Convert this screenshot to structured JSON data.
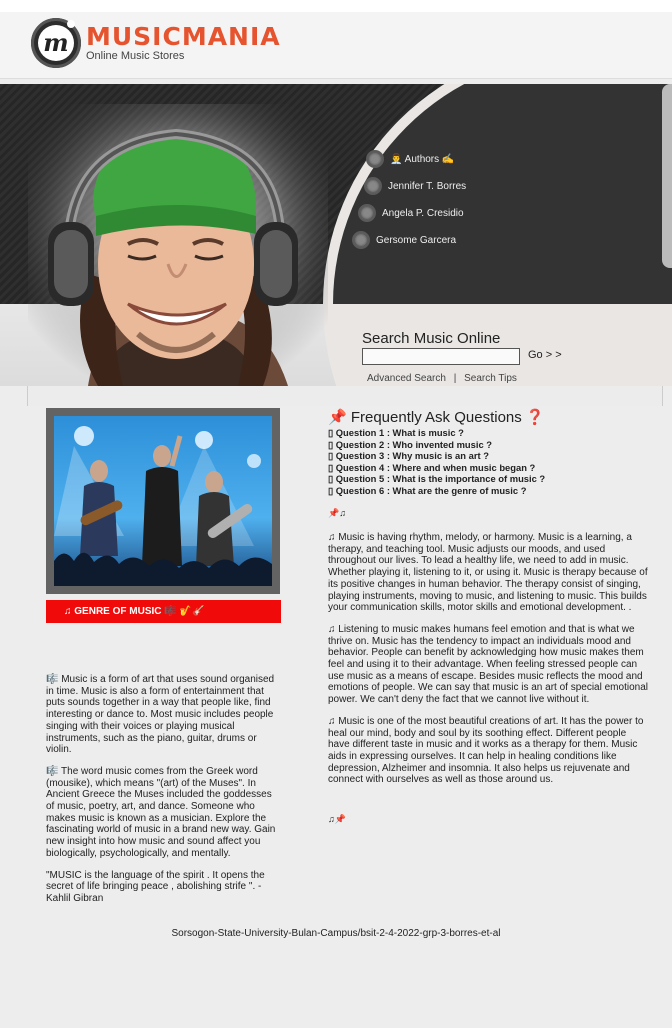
{
  "brand": {
    "name": "MUSICMANIA",
    "tagline": "Online Music Stores",
    "logo_letter": "m"
  },
  "nav": {
    "items": [
      {
        "label": "👨‍💼 Authors ✍"
      },
      {
        "label": "Jennifer T. Borres"
      },
      {
        "label": "Angela P. Cresidio"
      },
      {
        "label": "Gersome Garcera"
      }
    ]
  },
  "search": {
    "title": "Search Music Online",
    "placeholder": "",
    "go_label": "Go > >",
    "advanced_label": "Advanced Search",
    "separator": "|",
    "tips_label": "Search Tips"
  },
  "sidebar": {
    "genre_label": "♫ GENRE OF MUSIC 🎼 🎷🎸",
    "paragraphs": [
      "🎼 Music is a form of art that uses sound organised in time. Music is also a form of entertainment that puts sounds together in a way that people like, find interesting or dance to. Most music includes people singing with their voices or playing musical instruments, such as the piano, guitar, drums or violin.",
      "🎼 The word music comes from the Greek word (mousike), which means \"(art) of the Muses\". In Ancient Greece the Muses included the goddesses of music, poetry, art, and dance. Someone who makes music is known as a musician. Explore the fascinating world of music in a brand new way. Gain new insight into how music and sound affect you biologically, psychologically, and mentally.",
      "\"MUSIC is the language of the spirit . It opens the secret of life bringing peace , abolishing strife \". -Kahlil Gibran"
    ]
  },
  "faq": {
    "title": "📌 Frequently Ask Questions ❓",
    "questions": [
      "▯ Question 1 : What is music ?",
      "▯ Question 2 : Who invented music ?",
      "▯ Question 3 : Why music is an art ?",
      "▯ Question 4 : Where and when music began ?",
      "▯ Question 5 : What is the importance of music ?",
      "▯ Question 6 : What are the genre of music ?"
    ],
    "pin_top": "📌♫",
    "paragraphs": [
      "♫ Music is having rhythm, melody, or harmony. Music is a learning, a therapy, and teaching tool. Music adjusts our moods, and used throughout our lives. To lead a healthy life, we need to add in music. Whether playing it, listening to it, or using it. Music is therapy because of its positive changes in human behavior. The therapy consist of singing, playing instruments, moving to music, and listening to music. This builds your communication skills, motor skills and emotional development. .",
      "♫ Listening to music makes humans feel emotion and that is what we thrive on. Music has the tendency to impact an individuals mood and behavior. People can benefit by acknowledging how music makes them feel and using it to their advantage. When feeling stressed people can use music as a means of escape. Besides music reflects the mood and emotions of people. We can say that music is an art of special emotional power. We can't deny the fact that we cannot live without it.",
      "♫ Music is one of the most beautiful creations of art. It has the power to heal our mind, body and soul by its soothing effect. Different people have different taste in music and it works as a therapy for them. Music aids in expressing ourselves. It can help in healing conditions like depression, Alzheimer and insomnia. It also helps us rejuvenate and connect with ourselves as well as those around us."
    ],
    "pin_bottom": "♫📌"
  },
  "footer": {
    "text": "Sorsogon-State-University-Bulan-Campus/bsit-2-4-2022-grp-3-borres-et-al"
  },
  "colors": {
    "brand": "#e5542e",
    "genre_bar": "#f10a0a",
    "banner_dark": "#2a2a2a"
  }
}
